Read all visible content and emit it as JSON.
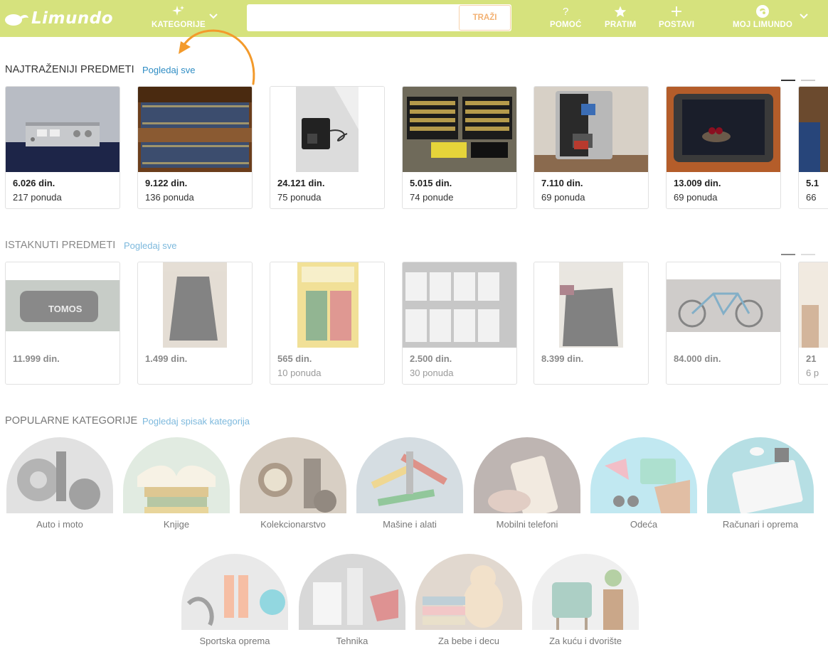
{
  "brand": {
    "logo_text": "Limundo",
    "header_bg": "#d6e27d",
    "accent_orange": "#f39a2b",
    "link_blue": "#2f8dc4"
  },
  "header": {
    "categories_label": "KATEGORIJE",
    "search": {
      "value": "",
      "placeholder": "",
      "button_label": "TRAŽI"
    },
    "help_label": "POMOĆ",
    "follow_label": "PRATIM",
    "post_label": "POSTAVI",
    "account_label": "MOJ LIMUNDO"
  },
  "most_wanted": {
    "title": "NAJTRAŽENIJI PREDMETI",
    "link": "Pogledaj sve",
    "items": [
      {
        "price": "6.026 din.",
        "bids": "217 ponuda"
      },
      {
        "price": "9.122 din.",
        "bids": "136 ponuda"
      },
      {
        "price": "24.121 din.",
        "bids": "75 ponuda"
      },
      {
        "price": "5.015 din.",
        "bids": "74 ponude"
      },
      {
        "price": "7.110 din.",
        "bids": "69 ponuda"
      },
      {
        "price": "13.009 din.",
        "bids": "69 ponuda"
      },
      {
        "price": "5.1",
        "bids": "66"
      }
    ]
  },
  "featured": {
    "title": "ISTAKNUTI PREDMETI",
    "link": "Pogledaj sve",
    "items": [
      {
        "price": "11.999 din.",
        "bids": ""
      },
      {
        "price": "1.499 din.",
        "bids": ""
      },
      {
        "price": "565 din.",
        "bids": "10 ponuda"
      },
      {
        "price": "2.500 din.",
        "bids": "30 ponuda"
      },
      {
        "price": "8.399 din.",
        "bids": ""
      },
      {
        "price": "84.000 din.",
        "bids": ""
      },
      {
        "price": "21",
        "bids": "6 p"
      }
    ]
  },
  "popular_categories": {
    "title": "POPULARNE KATEGORIJE",
    "link": "Pogledaj spisak kategorija",
    "items": [
      {
        "label": "Auto i moto",
        "icon": "car-parts-image"
      },
      {
        "label": "Knjige",
        "icon": "books-image"
      },
      {
        "label": "Kolekcionarstvo",
        "icon": "collectibles-image"
      },
      {
        "label": "Mašine i alati",
        "icon": "tools-image"
      },
      {
        "label": "Mobilni telefoni",
        "icon": "phone-image"
      },
      {
        "label": "Odeća",
        "icon": "clothing-image"
      },
      {
        "label": "Računari i oprema",
        "icon": "computer-image"
      },
      {
        "label": "Sportska oprema",
        "icon": "dumbbells-image"
      },
      {
        "label": "Tehnika",
        "icon": "appliances-image"
      },
      {
        "label": "Za bebe i decu",
        "icon": "toys-image"
      },
      {
        "label": "Za kuću i dvorište",
        "icon": "furniture-image"
      }
    ]
  }
}
